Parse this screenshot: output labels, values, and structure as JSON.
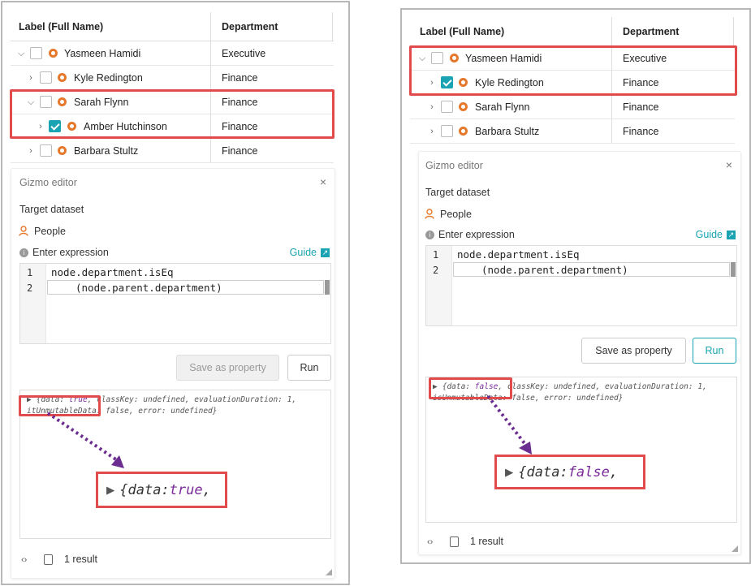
{
  "table": {
    "col_label": "Label (Full Name)",
    "col_department": "Department"
  },
  "left": {
    "rows": [
      {
        "name": "Yasmeen Hamidi",
        "department": "Executive",
        "expanded": true,
        "checked": false
      },
      {
        "name": "Kyle Redington",
        "department": "Finance",
        "expanded": false,
        "checked": false
      },
      {
        "name": "Sarah Flynn",
        "department": "Finance",
        "expanded": true,
        "checked": false
      },
      {
        "name": "Amber Hutchinson",
        "department": "Finance",
        "expanded": false,
        "checked": true
      },
      {
        "name": "Barbara Stultz",
        "department": "Finance",
        "expanded": false,
        "checked": false
      }
    ],
    "output_line1_prefix": "{data: ",
    "output_value": "true",
    "output_line1_rest": ", classKey: undefined, evaluationDuration: 1,",
    "output_line2": "itUnmutableData: false, error: undefined}",
    "zoom_prefix": "{data: ",
    "zoom_value": "true",
    "zoom_suffix": ","
  },
  "right": {
    "rows": [
      {
        "name": "Yasmeen Hamidi",
        "department": "Executive",
        "expanded": true,
        "checked": false
      },
      {
        "name": "Kyle Redington",
        "department": "Finance",
        "expanded": false,
        "checked": true
      },
      {
        "name": "Sarah Flynn",
        "department": "Finance",
        "expanded": false,
        "checked": false
      },
      {
        "name": "Barbara Stultz",
        "department": "Finance",
        "expanded": false,
        "checked": false
      }
    ],
    "output_line1_prefix": "{data: ",
    "output_value": "false",
    "output_line1_rest": ", classKey: undefined, evaluationDuration: 1,",
    "output_line2": "isUnmutableData: false, error: undefined}",
    "zoom_prefix": "{data: ",
    "zoom_value": "false",
    "zoom_suffix": ","
  },
  "editor": {
    "title": "Gizmo editor",
    "close": "×",
    "target_label": "Target dataset",
    "dataset": "People",
    "expr_label": "Enter expression",
    "guide": "Guide",
    "code_line1": "node.department.isEq",
    "code_line2": "(node.parent.department)",
    "line_no_1": "1",
    "line_no_2": "2",
    "save_button": "Save as property",
    "run_button": "Run",
    "result_count": "1 result"
  },
  "colors": {
    "highlight": "#e24b4b",
    "teal": "#1aa3b2",
    "node_icon": "#e6782b",
    "keyword": "#7a2a9a",
    "arrow": "#6b2d8f"
  }
}
